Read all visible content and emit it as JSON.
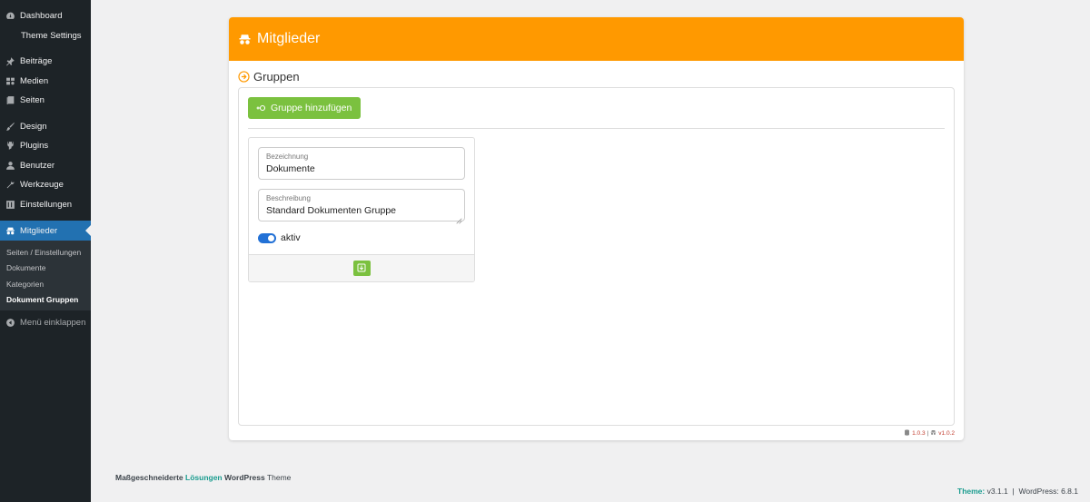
{
  "sidebar": {
    "items": [
      {
        "label": "Dashboard",
        "icon": "dashboard-icon"
      },
      {
        "label": "Theme Settings"
      },
      {
        "label": "Beiträge",
        "icon": "pin-icon"
      },
      {
        "label": "Medien",
        "icon": "media-icon"
      },
      {
        "label": "Seiten",
        "icon": "pages-icon"
      },
      {
        "label": "Design",
        "icon": "brush-icon"
      },
      {
        "label": "Plugins",
        "icon": "plugin-icon"
      },
      {
        "label": "Benutzer",
        "icon": "user-icon"
      },
      {
        "label": "Werkzeuge",
        "icon": "wrench-icon"
      },
      {
        "label": "Einstellungen",
        "icon": "settings-icon"
      },
      {
        "label": "Mitglieder",
        "icon": "members-icon"
      }
    ],
    "submenu": [
      "Seiten / Einstellungen",
      "Dokumente",
      "Kategorien",
      "Dokument Gruppen"
    ],
    "collapse_label": "Menü einklappen"
  },
  "panel": {
    "title": "Mitglieder",
    "section_title": "Gruppen",
    "add_button": "Gruppe hinzufügen",
    "card": {
      "name_label": "Bezeichnung",
      "name_value": "Dokumente",
      "desc_label": "Beschreibung",
      "desc_value": "Standard Dokumenten Gruppe",
      "active_label": "aktiv",
      "active": true
    },
    "version_a": "1.0.3",
    "version_sep": "|",
    "version_b": "v1.0.2"
  },
  "footer": {
    "left_part1": "Maßgeschneiderte",
    "left_part2": "Lösungen",
    "left_part3": "WordPress",
    "left_part4": "Theme",
    "theme_label": "Theme:",
    "theme_version": "v3.1.1",
    "sep": "|",
    "wp_label": "WordPress:",
    "wp_version": "6.8.1"
  },
  "colors": {
    "accent_orange": "#ff9900",
    "button_green": "#7bc13f",
    "sidebar_bg": "#1d2327",
    "active_blue": "#2271b1"
  }
}
